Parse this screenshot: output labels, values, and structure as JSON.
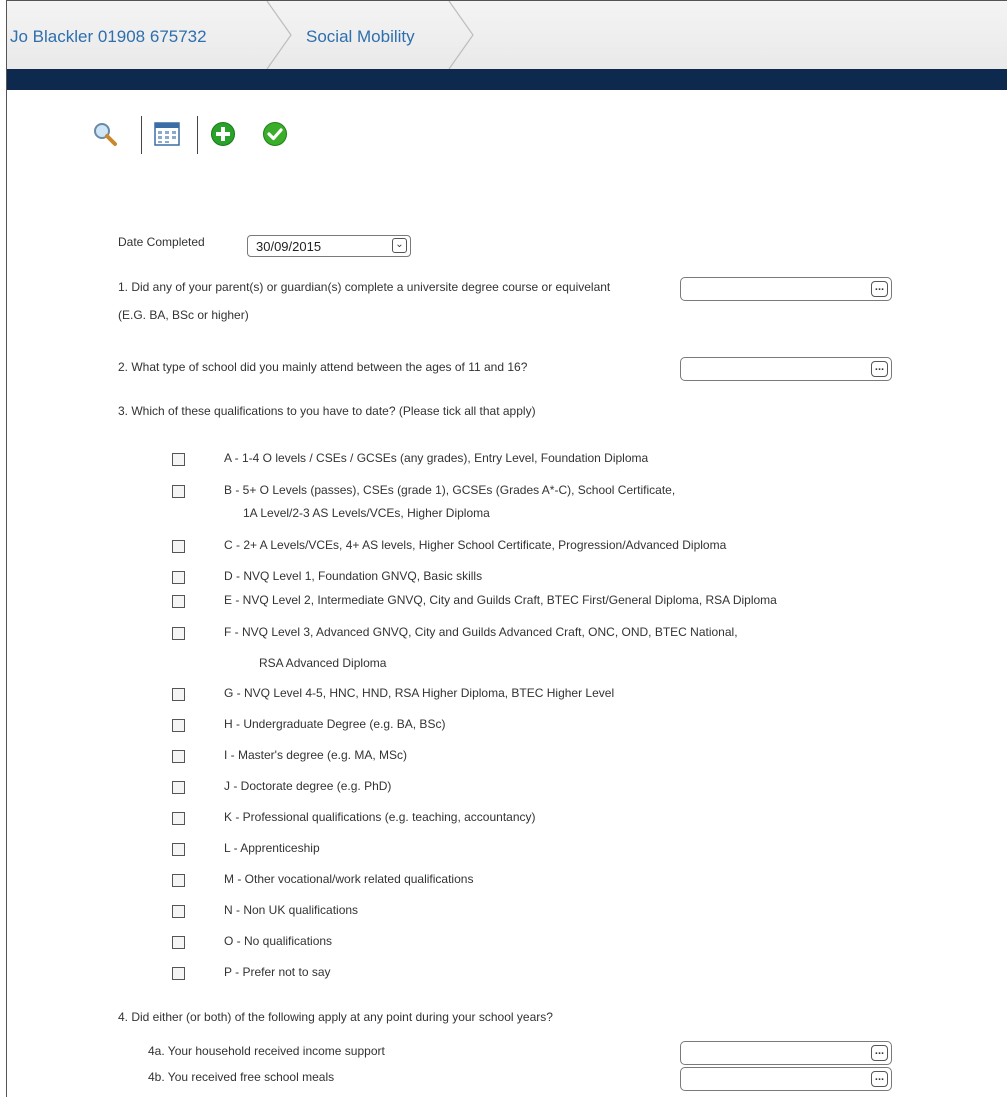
{
  "breadcrumb": [
    {
      "label": "Jo Blackler 01908 675732"
    },
    {
      "label": "Social Mobility"
    }
  ],
  "toolbar": {
    "icons": [
      "search-icon",
      "calendar-icon",
      "add-icon",
      "confirm-icon"
    ],
    "colors": {
      "add": "#2aa12a",
      "confirm": "#3aae2a",
      "navband": "#0d2a4e",
      "link": "#2e6fad"
    }
  },
  "form": {
    "date_label": "Date Completed",
    "date_value": "30/09/2015",
    "q1": "1. Did any of your parent(s) or guardian(s) complete a universite degree course or equivelant",
    "q1_note": "(E.G. BA, BSc or higher)",
    "q2": "2. What type of school did you mainly attend between the ages of 11 and 16?",
    "q3": "3. Which of these qualifications to you have to date? (Please tick all that apply)",
    "q3_options": [
      {
        "line1": "A - 1-4 O levels / CSEs / GCSEs (any grades), Entry Level, Foundation Diploma"
      },
      {
        "line1": "B - 5+ O Levels (passes), CSEs (grade 1), GCSEs (Grades A*-C), School Certificate,",
        "line2": "1A Level/2-3 AS Levels/VCEs, Higher Diploma"
      },
      {
        "line1": "C - 2+ A Levels/VCEs, 4+ AS levels, Higher School Certificate, Progression/Advanced Diploma"
      },
      {
        "line1": "D - NVQ Level 1, Foundation GNVQ, Basic skills"
      },
      {
        "line1": "E - NVQ Level 2, Intermediate GNVQ, City and Guilds Craft, BTEC First/General Diploma, RSA Diploma"
      },
      {
        "line1": "F - NVQ Level 3, Advanced GNVQ, City and Guilds Advanced Craft, ONC, OND, BTEC National,",
        "line2": "RSA Advanced Diploma"
      },
      {
        "line1": "G - NVQ Level 4-5, HNC, HND, RSA Higher Diploma, BTEC Higher Level"
      },
      {
        "line1": "H - Undergraduate Degree (e.g. BA, BSc)"
      },
      {
        "line1": "I - Master's degree (e.g. MA, MSc)"
      },
      {
        "line1": "J - Doctorate degree (e.g. PhD)"
      },
      {
        "line1": "K - Professional qualifications (e.g. teaching, accountancy)"
      },
      {
        "line1": "L - Apprenticeship"
      },
      {
        "line1": "M - Other vocational/work related qualifications"
      },
      {
        "line1": "N - Non UK qualifications"
      },
      {
        "line1": "O - No qualifications"
      },
      {
        "line1": "P - Prefer not to say"
      }
    ],
    "q4": "4. Did either (or both) of the following apply at any point during your school years?",
    "q4a": "4a. Your household received income support",
    "q4b": "4b. You received free school meals",
    "lookup_button": "..."
  }
}
